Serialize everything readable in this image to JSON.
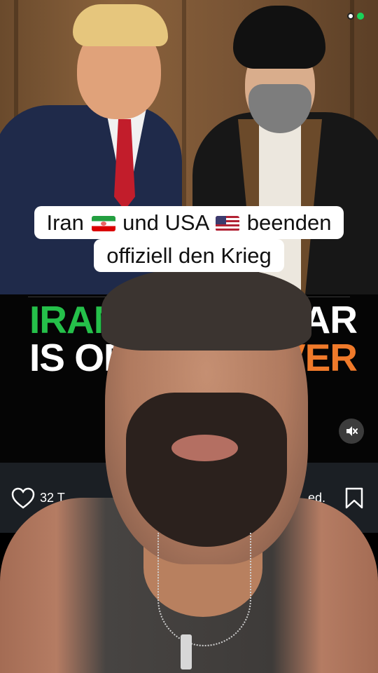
{
  "caption": {
    "line1_part1": "Iran",
    "line1_flag1": "iran-flag",
    "line1_part2": "und USA",
    "line1_flag2": "usa-flag",
    "line1_part3": "beenden",
    "line2": "offiziell den Krieg"
  },
  "headline": {
    "line1_left": "IRAN",
    "line1_right": "AR",
    "line2_left": "IS OFF",
    "line2_right": "OVER"
  },
  "actions": {
    "like_count": "32 T",
    "liked_by_fragment": "ed.",
    "like_icon": "heart-outline-icon",
    "bookmark_icon": "bookmark-outline-icon",
    "mute_icon": "speaker-muted-icon"
  },
  "status_indicators": [
    "white-dot",
    "green-dot"
  ],
  "colors": {
    "headline_green": "#25c04a",
    "headline_white": "#ffffff",
    "headline_orange": "#f07a2a",
    "caption_bg": "#ffffff",
    "action_bar_bg": "#1b1f24"
  }
}
